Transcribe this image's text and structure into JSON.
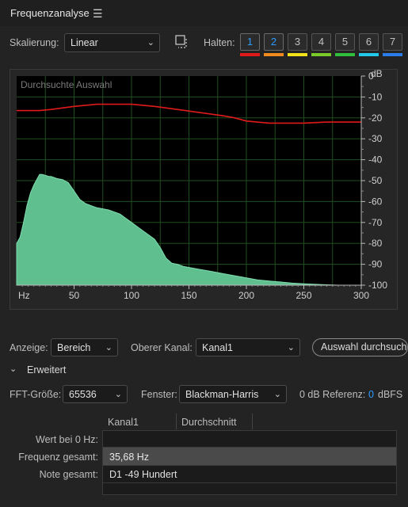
{
  "panel": {
    "title": "Frequenzanalyse",
    "menu_icon": "hamburger-icon"
  },
  "toolbar": {
    "scaling_label": "Skalierung:",
    "scaling_value": "Linear",
    "hold_label": "Halten:",
    "hold_buttons": [
      "1",
      "2",
      "3",
      "4",
      "5",
      "6",
      "7"
    ],
    "hold_selected": [
      "1",
      "2"
    ],
    "hold_colors": [
      "#e01a1a",
      "#f08a1e",
      "#f2e21a",
      "#7acb2a",
      "#2fbf3a",
      "#22c8e8",
      "#2a7de8"
    ]
  },
  "chart_data": {
    "type": "area",
    "title": "Durchsuchte Auswahl",
    "xlabel": "Hz",
    "ylabel": "dB",
    "xlim": [
      0,
      300
    ],
    "ylim": [
      -100,
      0
    ],
    "x_ticks": [
      "50",
      "100",
      "150",
      "200",
      "250",
      "300"
    ],
    "y_ticks": [
      "0",
      "-10",
      "-20",
      "-30",
      "-40",
      "-50",
      "-60",
      "-70",
      "-80",
      "-90",
      "-100"
    ],
    "grid": true,
    "series": [
      {
        "kind": "area",
        "color": "#5fbf8f",
        "x": [
          0,
          3,
          6,
          9,
          12,
          15,
          18,
          20,
          22,
          25,
          28,
          30,
          35,
          40,
          45,
          50,
          55,
          60,
          65,
          70,
          75,
          80,
          85,
          90,
          95,
          100,
          105,
          110,
          115,
          120,
          125,
          130,
          135,
          140,
          145,
          150,
          160,
          170,
          180,
          190,
          200,
          210,
          220,
          230,
          240,
          250,
          260,
          270,
          280,
          290,
          300
        ],
        "y": [
          -80,
          -77,
          -70,
          -62,
          -56,
          -52,
          -49,
          -47,
          -47,
          -47.5,
          -48,
          -48,
          -49,
          -49.5,
          -51,
          -55,
          -59,
          -61,
          -62,
          -63,
          -63.5,
          -64,
          -65,
          -66,
          -68,
          -70,
          -72,
          -74,
          -76,
          -78,
          -82,
          -87,
          -89.5,
          -90,
          -91,
          -91.5,
          -92.5,
          -93.5,
          -94.5,
          -95.5,
          -96.5,
          -97.5,
          -98,
          -98.5,
          -99,
          -99.3,
          -99.6,
          -99.8,
          -100,
          -100,
          -100
        ]
      },
      {
        "kind": "line",
        "color": "#e01a1a",
        "x": [
          0,
          20,
          30,
          50,
          70,
          80,
          100,
          120,
          140,
          160,
          180,
          190,
          200,
          220,
          250,
          270,
          300
        ],
        "y": [
          -16.5,
          -16.5,
          -16,
          -14.5,
          -13.5,
          -13.5,
          -13.5,
          -14.5,
          -16,
          -17.5,
          -19,
          -20,
          -21.5,
          -22.5,
          -22.5,
          -22,
          -22
        ]
      }
    ]
  },
  "display": {
    "anzeige_label": "Anzeige:",
    "anzeige_value": "Bereich",
    "kanal_label": "Oberer Kanal:",
    "kanal_value": "Kanal1",
    "scan_button": "Auswahl durchsuchen"
  },
  "advanced": {
    "label": "Erweitert",
    "fft_label": "FFT-Größe:",
    "fft_value": "65536",
    "window_label": "Fenster:",
    "window_value": "Blackman-Harris",
    "ref_label": "0 dB Referenz:",
    "ref_value": "0",
    "ref_unit": "dBFS"
  },
  "table": {
    "columns": [
      "Kanal1",
      "Durchschnitt"
    ],
    "rows": [
      {
        "label": "Wert bei 0 Hz:",
        "value": ""
      },
      {
        "label": "Frequenz gesamt:",
        "value": "35,68 Hz"
      },
      {
        "label": "Note gesamt:",
        "value": "D1 -49 Hundert"
      }
    ]
  }
}
